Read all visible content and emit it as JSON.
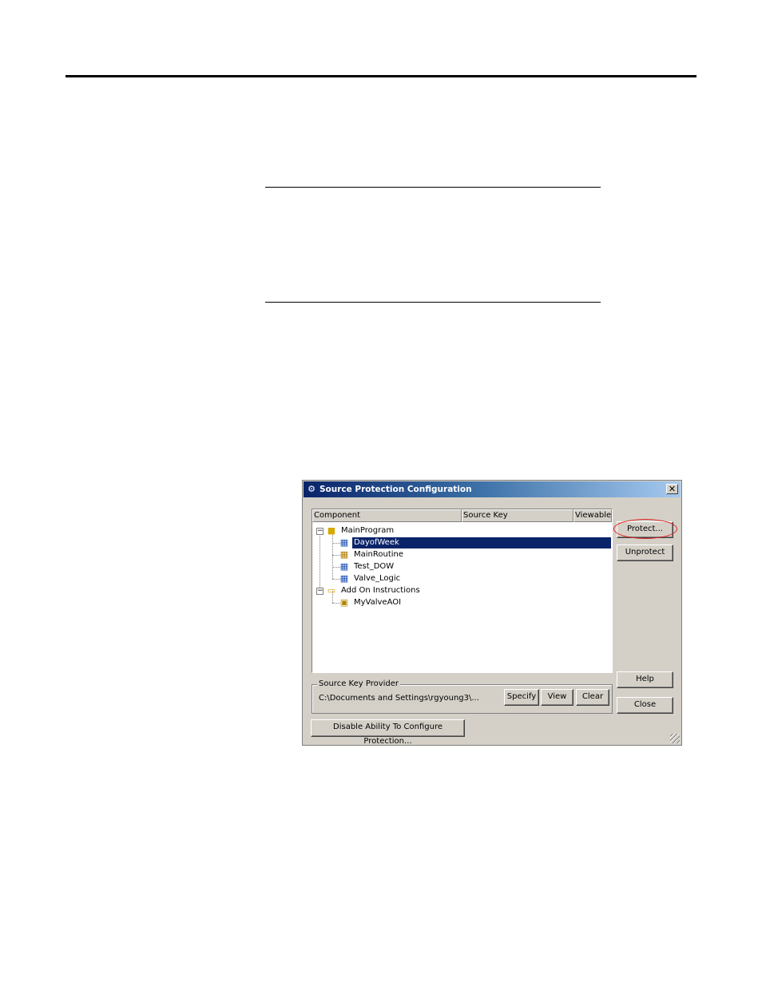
{
  "dialog": {
    "title": "Source Protection Configuration",
    "columns": [
      "Component",
      "Source Key",
      "Viewable"
    ],
    "tree": [
      {
        "label": "MainProgram",
        "icon": "folder-program-icon"
      },
      {
        "label": "DayofWeek",
        "icon": "routine-icon",
        "selected": true
      },
      {
        "label": "MainRoutine",
        "icon": "main-routine-icon"
      },
      {
        "label": "Test_DOW",
        "icon": "routine-icon"
      },
      {
        "label": "Valve_Logic",
        "icon": "routine-icon"
      },
      {
        "label": "Add On Instructions",
        "icon": "folder-icon"
      },
      {
        "label": "MyValveAOI",
        "icon": "aoi-icon"
      }
    ],
    "buttons": {
      "protect": "Protect...",
      "unprotect": "Unprotect",
      "help": "Help",
      "close": "Close",
      "specify": "Specify",
      "view": "View",
      "clear": "Clear",
      "disable": "Disable Ability To Configure Protection..."
    },
    "source_key_provider": {
      "label": "Source Key Provider",
      "path": "C:\\Documents and Settings\\rgyoung3\\..."
    },
    "close_glyph": "✕",
    "app_glyph": "⚙",
    "expander_collapse": "−"
  }
}
